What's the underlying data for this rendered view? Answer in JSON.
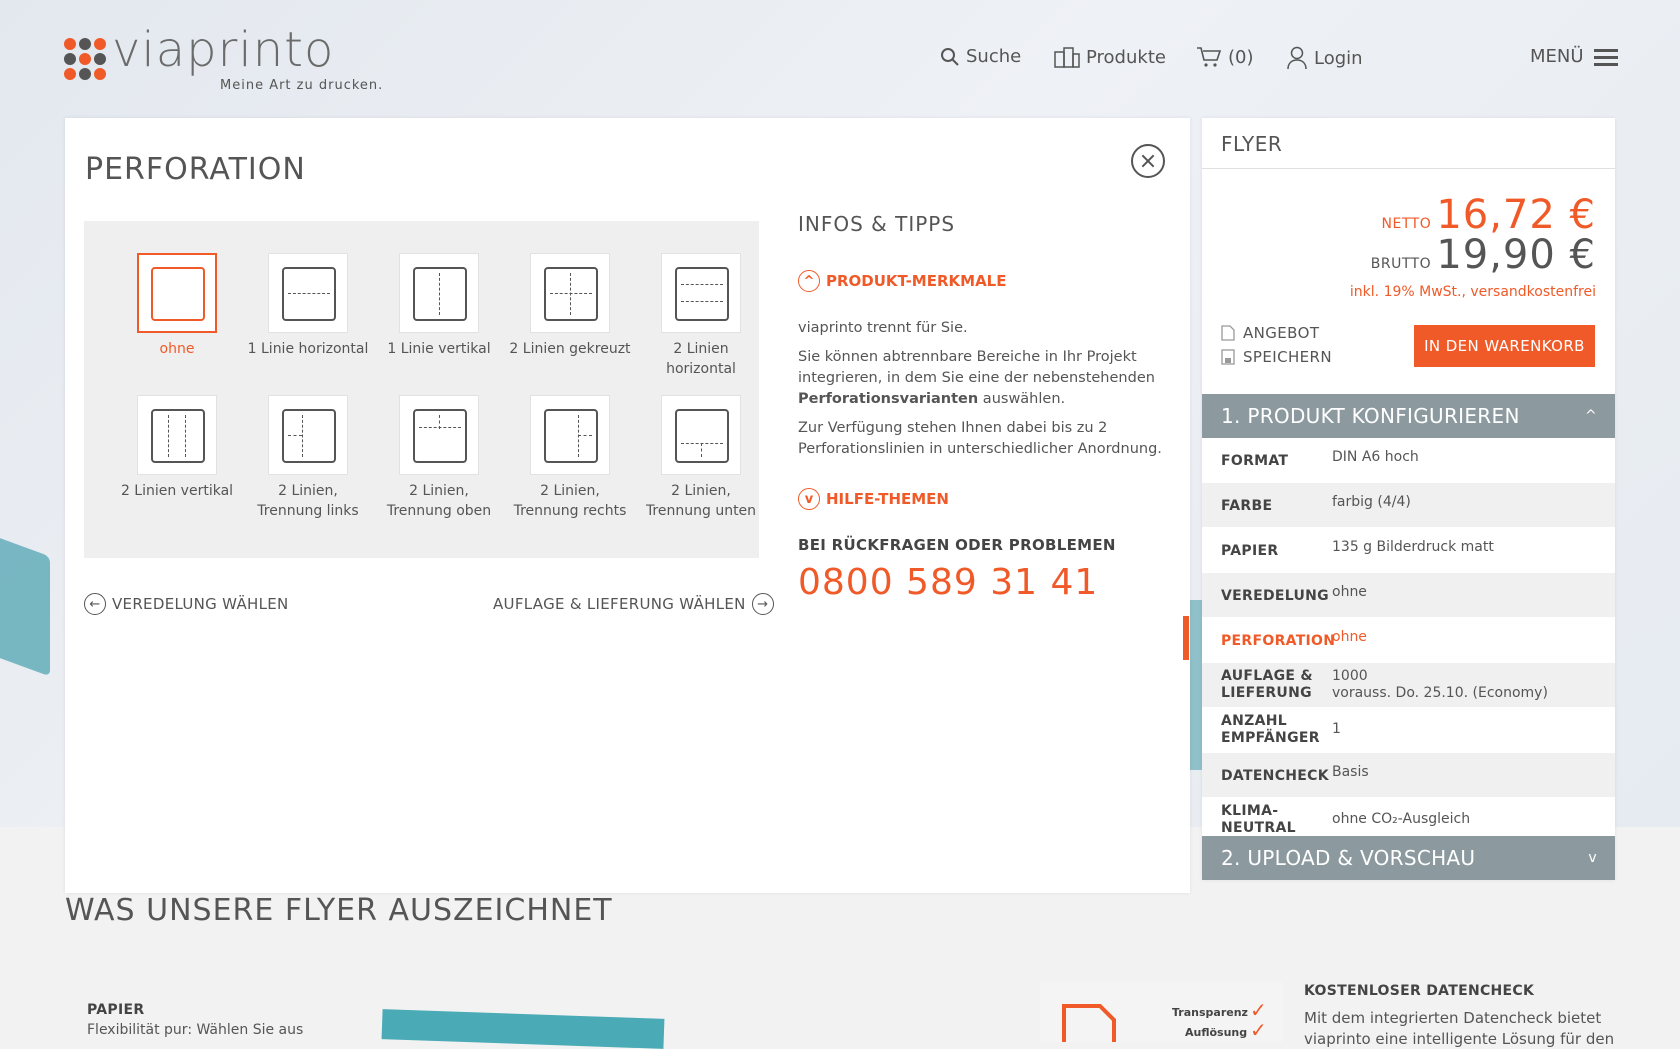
{
  "brand": {
    "name": "viaprinto",
    "tagline": "Meine Art zu drucken."
  },
  "nav": {
    "search": "Suche",
    "products": "Produkte",
    "cart": "(0)",
    "login": "Login",
    "menu": "MENÜ"
  },
  "panel": {
    "title": "PERFORATION",
    "options": [
      {
        "label": "ohne"
      },
      {
        "label": "1 Linie horizontal"
      },
      {
        "label": "1 Linie vertikal"
      },
      {
        "label": "2 Linien gekreuzt"
      },
      {
        "label": "2 Linien\nhorizontal"
      },
      {
        "label": "2 Linien vertikal"
      },
      {
        "label": "2 Linien,\nTrennung links"
      },
      {
        "label": "2 Linien,\nTrennung oben"
      },
      {
        "label": "2 Linien,\nTrennung rechts"
      },
      {
        "label": "2 Linien,\nTrennung unten"
      }
    ],
    "selected": "ohne",
    "back_link": "VEREDELUNG WÄHLEN",
    "next_link": "AUFLAGE & LIEFERUNG WÄHLEN"
  },
  "info": {
    "title": "INFOS & TIPPS",
    "merkmale": "PRODUKT-MERKMALE",
    "p1": "viaprinto trennt für Sie.",
    "p2_a": "Sie können abtrennbare Bereiche in Ihr Projekt integrieren, in dem Sie eine der nebenstehenden ",
    "p2_b": "Perforationsvarianten",
    "p2_c": " auswählen.",
    "p3": "Zur Verfügung stehen Ihnen dabei bis zu 2 Perforationslinien in unterschiedlicher Anordnung.",
    "hilfe": "HILFE-THEMEN",
    "hotline_label": "BEI RÜCKFRAGEN ODER PROBLEMEN",
    "hotline": "0800 589 31 41"
  },
  "sidebar": {
    "title": "FLYER",
    "netto_label": "NETTO",
    "netto": "16,72 €",
    "brutto_label": "BRUTTO",
    "brutto": "19,90 €",
    "tax_note": "inkl. 19% MwSt., versandkostenfrei",
    "offer": "ANGEBOT",
    "save": "SPEICHERN",
    "cart_button": "IN DEN WARENKORB",
    "section1": "1. PRODUKT KONFIGURIEREN",
    "section2": "2. UPLOAD & VORSCHAU",
    "config": [
      {
        "key": "FORMAT",
        "value": "DIN A6 hoch"
      },
      {
        "key": "FARBE",
        "value": "farbig (4/4)"
      },
      {
        "key": "PAPIER",
        "value": "135 g Bilderdruck matt"
      },
      {
        "key": "VEREDELUNG",
        "value": "ohne"
      },
      {
        "key": "PERFORATION",
        "value": "ohne"
      },
      {
        "key": "AUFLAGE &\nLIEFERUNG",
        "value": "1000\nvorauss. Do. 25.10. (Economy)"
      },
      {
        "key": "ANZAHL\nEMPFÄNGER",
        "value": "1"
      },
      {
        "key": "DATENCHECK",
        "value": "Basis"
      },
      {
        "key": "KLIMA-\nNEUTRAL",
        "value": "ohne CO₂-Ausgleich"
      }
    ]
  },
  "features": {
    "title": "WAS UNSERE FLYER AUSZEICHNET",
    "paper_label": "PAPIER",
    "paper_text": "Flexibilität pur: Wählen Sie aus",
    "check_label": "KOSTENLOSER DATENCHECK",
    "check_text": "Mit dem integrierten Datencheck bietet",
    "check_text2": "viaprinto eine intelligente Lösung für den",
    "thumb_t1": "Transparenz",
    "thumb_t2": "Auflösung"
  },
  "colors": {
    "accent": "#f05a28",
    "section": "#8c9a9f"
  }
}
